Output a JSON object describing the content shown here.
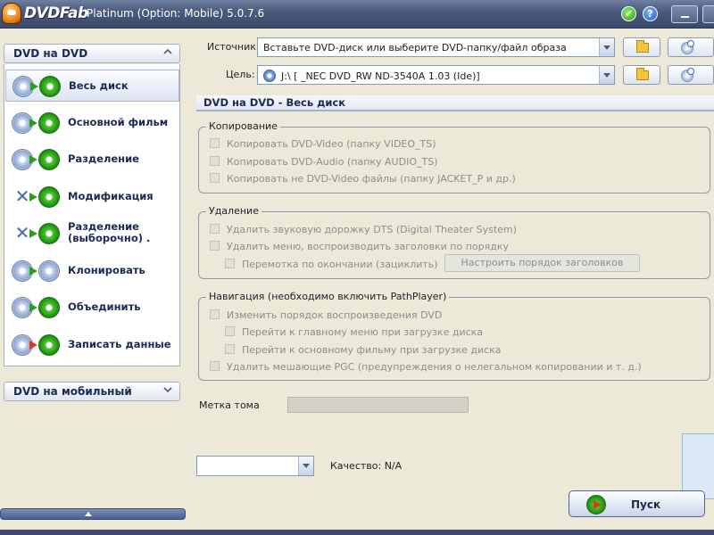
{
  "window": {
    "brand": "DVDFab",
    "title": "Platinum (Option: Mobile) 5.0.7.6",
    "check_glyph": "✔",
    "help_glyph": "?"
  },
  "sidebar": {
    "section_dvd": "DVD на DVD",
    "section_mobile": "DVD на мобильный",
    "items": [
      {
        "label": "Весь диск",
        "icon": "full-disc-icon"
      },
      {
        "label": "Основной фильм",
        "icon": "main-movie-icon"
      },
      {
        "label": "Разделение",
        "icon": "split-icon"
      },
      {
        "label": "Модификация",
        "icon": "customize-icon"
      },
      {
        "label": "Разделение (выборочно) .",
        "icon": "customize-split-icon"
      },
      {
        "label": "Клонировать",
        "icon": "clone-icon"
      },
      {
        "label": "Объединить",
        "icon": "merge-icon"
      },
      {
        "label": "Записать данные",
        "icon": "write-data-icon"
      }
    ]
  },
  "source": {
    "label": "Источник:",
    "value": "Вставьте DVD-диск или выберите DVD-папку/файл образа"
  },
  "target": {
    "label": "Цель:",
    "value": "J:\\ [ _NEC DVD_RW ND-3540A 1.03 (Ide)]"
  },
  "mode_title": "DVD на DVD - Весь диск",
  "copy_group": {
    "title": "Копирование",
    "options": [
      "Копировать DVD-Video (папку VIDEO_TS)",
      "Копировать DVD-Audio (папку AUDIO_TS)",
      "Копировать не DVD-Video файлы (папку JACKET_P и др.)"
    ]
  },
  "remove_group": {
    "title": "Удаление",
    "options": [
      "Удалить звуковую дорожку DTS (Digital Theater System)",
      "Удалить меню, воспроизводить заголовки по порядку",
      "Перемотка по окончании (зациклить)"
    ],
    "order_button": "Настроить порядок заголовков"
  },
  "nav_group": {
    "title": "Навигация (необходимо включить PathPlayer)",
    "options": [
      "Изменить порядок воспроизведения DVD",
      "Перейти к главному меню при загрузке диска",
      "Перейти к основному фильму при загрузке диска",
      "Удалить мешающие PGC (предупреждения о нелегальном копировании и т. д.)"
    ]
  },
  "volume": {
    "label": "Метка тома",
    "value": ""
  },
  "quality": {
    "combo_value": "",
    "text": "Качество: N/A"
  },
  "start_button": "Пуск",
  "colors": {
    "accent": "#1a2a55",
    "titlebar": "#4b5b7e",
    "start_green": "#2f9c1d",
    "disabled_text": "#8d8d8d"
  }
}
